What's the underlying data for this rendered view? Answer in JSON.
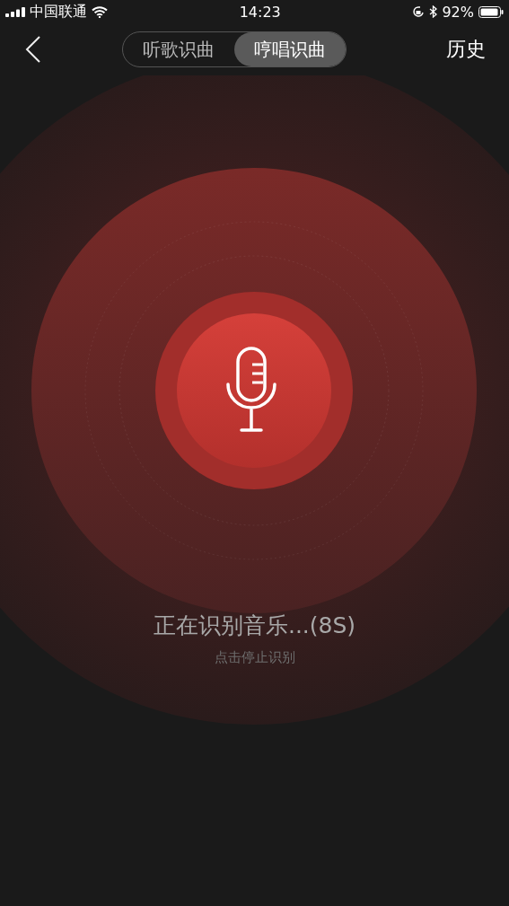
{
  "status_bar": {
    "carrier": "中国联通",
    "time": "14:23",
    "battery": "92%"
  },
  "nav": {
    "tabs": [
      {
        "label": "听歌识曲",
        "selected": false
      },
      {
        "label": "哼唱识曲",
        "selected": true
      }
    ],
    "history": "历史"
  },
  "recognition": {
    "title": "正在识别音乐...(8S)",
    "hint": "点击停止识别"
  }
}
